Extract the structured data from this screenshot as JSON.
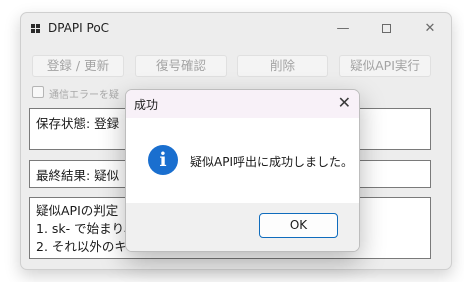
{
  "window": {
    "title": "DPAPI PoC",
    "controls": {
      "minimize": "—",
      "close": "✕"
    }
  },
  "toolbar": {
    "buttons": [
      "登録 / 更新",
      "復号確認",
      "削除",
      "疑似API実行"
    ]
  },
  "checkbox": {
    "label": "通信エラーを疑",
    "checked": false
  },
  "status": {
    "save_state": "保存状態: 登録",
    "final_result": "最終結果: 疑似",
    "rules": [
      "疑似APIの判定",
      "1. sk- で始まり、",
      "2. それ以外のキ"
    ]
  },
  "dialog": {
    "title": "成功",
    "close": "✕",
    "icon": "info-icon",
    "message": "疑似API呼出に成功しました。",
    "ok_label": "OK"
  },
  "colors": {
    "accent": "#0f6cbd",
    "info_icon": "#1a6fcf"
  }
}
